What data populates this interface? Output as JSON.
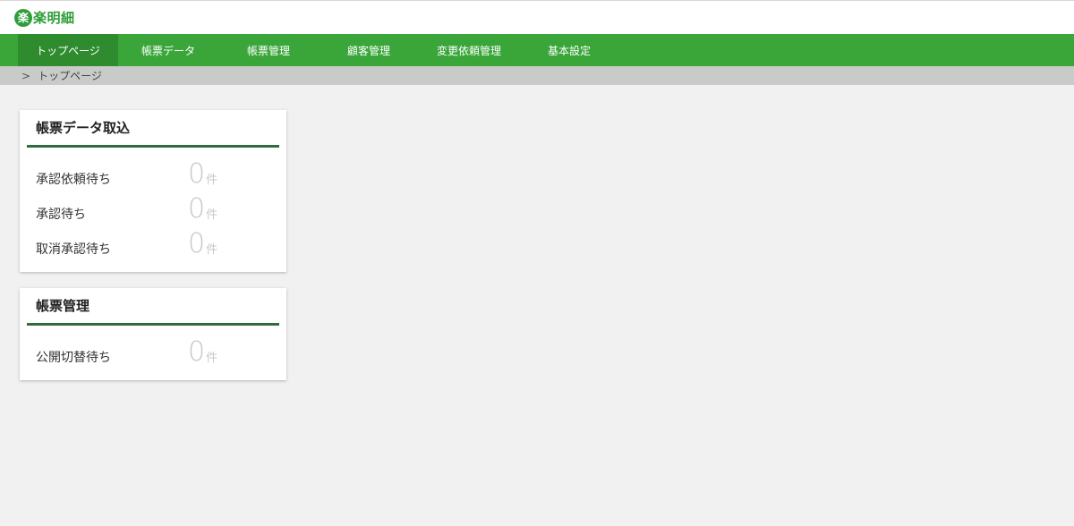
{
  "header": {
    "logo_badge": "楽",
    "logo_text": "楽明細"
  },
  "nav": {
    "items": [
      {
        "label": "トップページ",
        "active": true
      },
      {
        "label": "帳票データ"
      },
      {
        "label": "帳票管理"
      },
      {
        "label": "顧客管理"
      },
      {
        "label": "変更依頼管理"
      },
      {
        "label": "基本設定"
      }
    ]
  },
  "breadcrumb": {
    "separator": ">",
    "current": "トップページ"
  },
  "cards": [
    {
      "title": "帳票データ取込",
      "rows": [
        {
          "label": "承認依頼待ち",
          "value": "0",
          "unit": "件"
        },
        {
          "label": "承認待ち",
          "value": "0",
          "unit": "件"
        },
        {
          "label": "取消承認待ち",
          "value": "0",
          "unit": "件"
        }
      ]
    },
    {
      "title": "帳票管理",
      "rows": [
        {
          "label": "公開切替待ち",
          "value": "0",
          "unit": "件"
        }
      ]
    }
  ],
  "colors": {
    "brand_green": "#3aa639",
    "nav_active": "#2e8b2e",
    "card_accent": "#2f6b3e",
    "count_gray": "#c8c8c8"
  }
}
